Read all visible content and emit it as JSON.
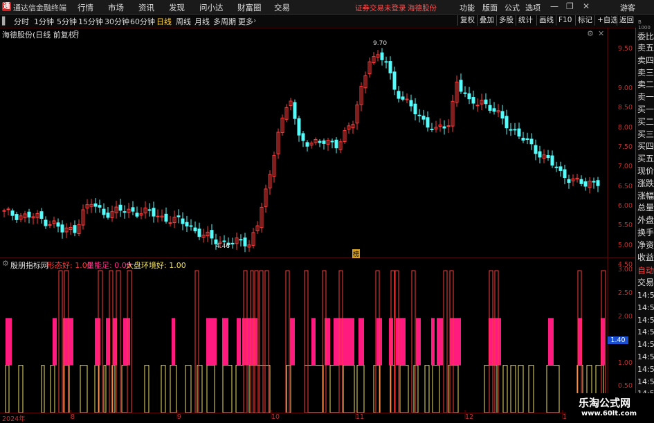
{
  "app": {
    "title": "通达信金融终端",
    "logo": "通"
  },
  "menu": [
    "行情",
    "市场",
    "资讯",
    "发现",
    "问小达",
    "财富圈",
    "交易"
  ],
  "notice": "证券交易未登录",
  "stock_name_top": "海德股份",
  "right_menu": [
    "功能",
    "版面",
    "公式",
    "选项"
  ],
  "user": "游客",
  "window_buttons": {
    "minimize": "—",
    "restore": "❐",
    "close": "✕"
  },
  "periods": [
    "分时",
    "1分钟",
    "5分钟",
    "15分钟",
    "30分钟",
    "60分钟",
    "日线",
    "周线",
    "月线",
    "多周期",
    "更多"
  ],
  "active_period": "日线",
  "toolbar": [
    "复权",
    "叠加",
    "多股",
    "统计",
    "画线",
    "F10",
    "标记",
    "+自选",
    "返回"
  ],
  "chart_title": "海德股份(日线 前复权)",
  "price_axis": [
    "9.50",
    "9.00",
    "8.50",
    "8.00",
    "7.50",
    "7.00",
    "6.50",
    "6.00",
    "5.50",
    "5.00",
    "4.50"
  ],
  "high_label": "9.70",
  "low_label": "4.46",
  "event_marker": "榜",
  "indicator": {
    "name": "殷朋指标网",
    "params": [
      {
        "label": "形态好: 1.00",
        "color": "#ff3b3b"
      },
      {
        "label": "量能足: 0.00",
        "color": "#ff2a8a"
      },
      {
        "label": "大盘环境好: 1.00",
        "color": "#f0e060"
      }
    ],
    "axis": [
      "3.00",
      "2.50",
      "2.00",
      "1.50",
      "1.00",
      "0.50"
    ],
    "current_value": "1.40"
  },
  "right_panel": {
    "tab_top": "委比",
    "labels": [
      "卖五",
      "卖四",
      "卖三",
      "卖二",
      "卖一",
      "买一",
      "买二",
      "买三",
      "买四",
      "买五",
      "现价",
      "涨跌",
      "涨幅",
      "总量",
      "外盘",
      "换手",
      "净资",
      "收益"
    ],
    "auto": "自动",
    "trade": "交易",
    "times": [
      "14:56",
      "14:56",
      "14:56",
      "14:56",
      "14:56",
      "14:56",
      "14:56",
      "14:56",
      "14:56"
    ],
    "top_small": [
      "B",
      "1000"
    ]
  },
  "date_axis": [
    "2024年",
    "8",
    "9",
    "10",
    "11",
    "12",
    "1"
  ],
  "watermark": {
    "title": "乐淘公式网",
    "url": "www.60lt.com"
  },
  "colors": {
    "up": "#ff3b3b",
    "down": "#54fcfc",
    "pink": "#ff1a80",
    "yellow": "#f0e060",
    "axis": "#b02020"
  }
}
